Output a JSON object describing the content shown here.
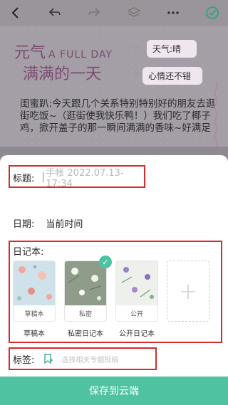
{
  "journal": {
    "title_line1": "元气",
    "title_latin": "A FULL DAY",
    "title_line2": "满满的一天",
    "weather": "天气:晴",
    "mood": "心情还不错",
    "body": "闺蜜趴:今天跟几个关系特别特别好的朋友去逛街吃饭~（逛街使我快乐鸭！）我们吃了椰子鸡，掀开盖子的那一瞬间满满的香味~好满足"
  },
  "form": {
    "title_label": "标题:",
    "title_placeholder": "手帐 2022.07.13-17:34",
    "date_label": "日期:",
    "date_value": "当前时间",
    "diary_label": "日记本:",
    "books": [
      {
        "cover_tag": "草稿本",
        "name": "草稿本"
      },
      {
        "cover_tag": "私密",
        "name": "私密日记本"
      },
      {
        "cover_tag": "公开",
        "name": "公开日记本"
      }
    ],
    "tags_label": "标签:",
    "tags_placeholder": "选择相关专题投稿",
    "save_label": "保存到云端"
  },
  "colors": {
    "accent": "#4fc2a2",
    "highlight": "#d62c2c"
  },
  "icons": [
    "back-icon",
    "undo-icon",
    "redo-icon",
    "layers-icon",
    "more-icon",
    "done-check-icon",
    "tag-icon",
    "add-icon",
    "selected-check-icon"
  ]
}
